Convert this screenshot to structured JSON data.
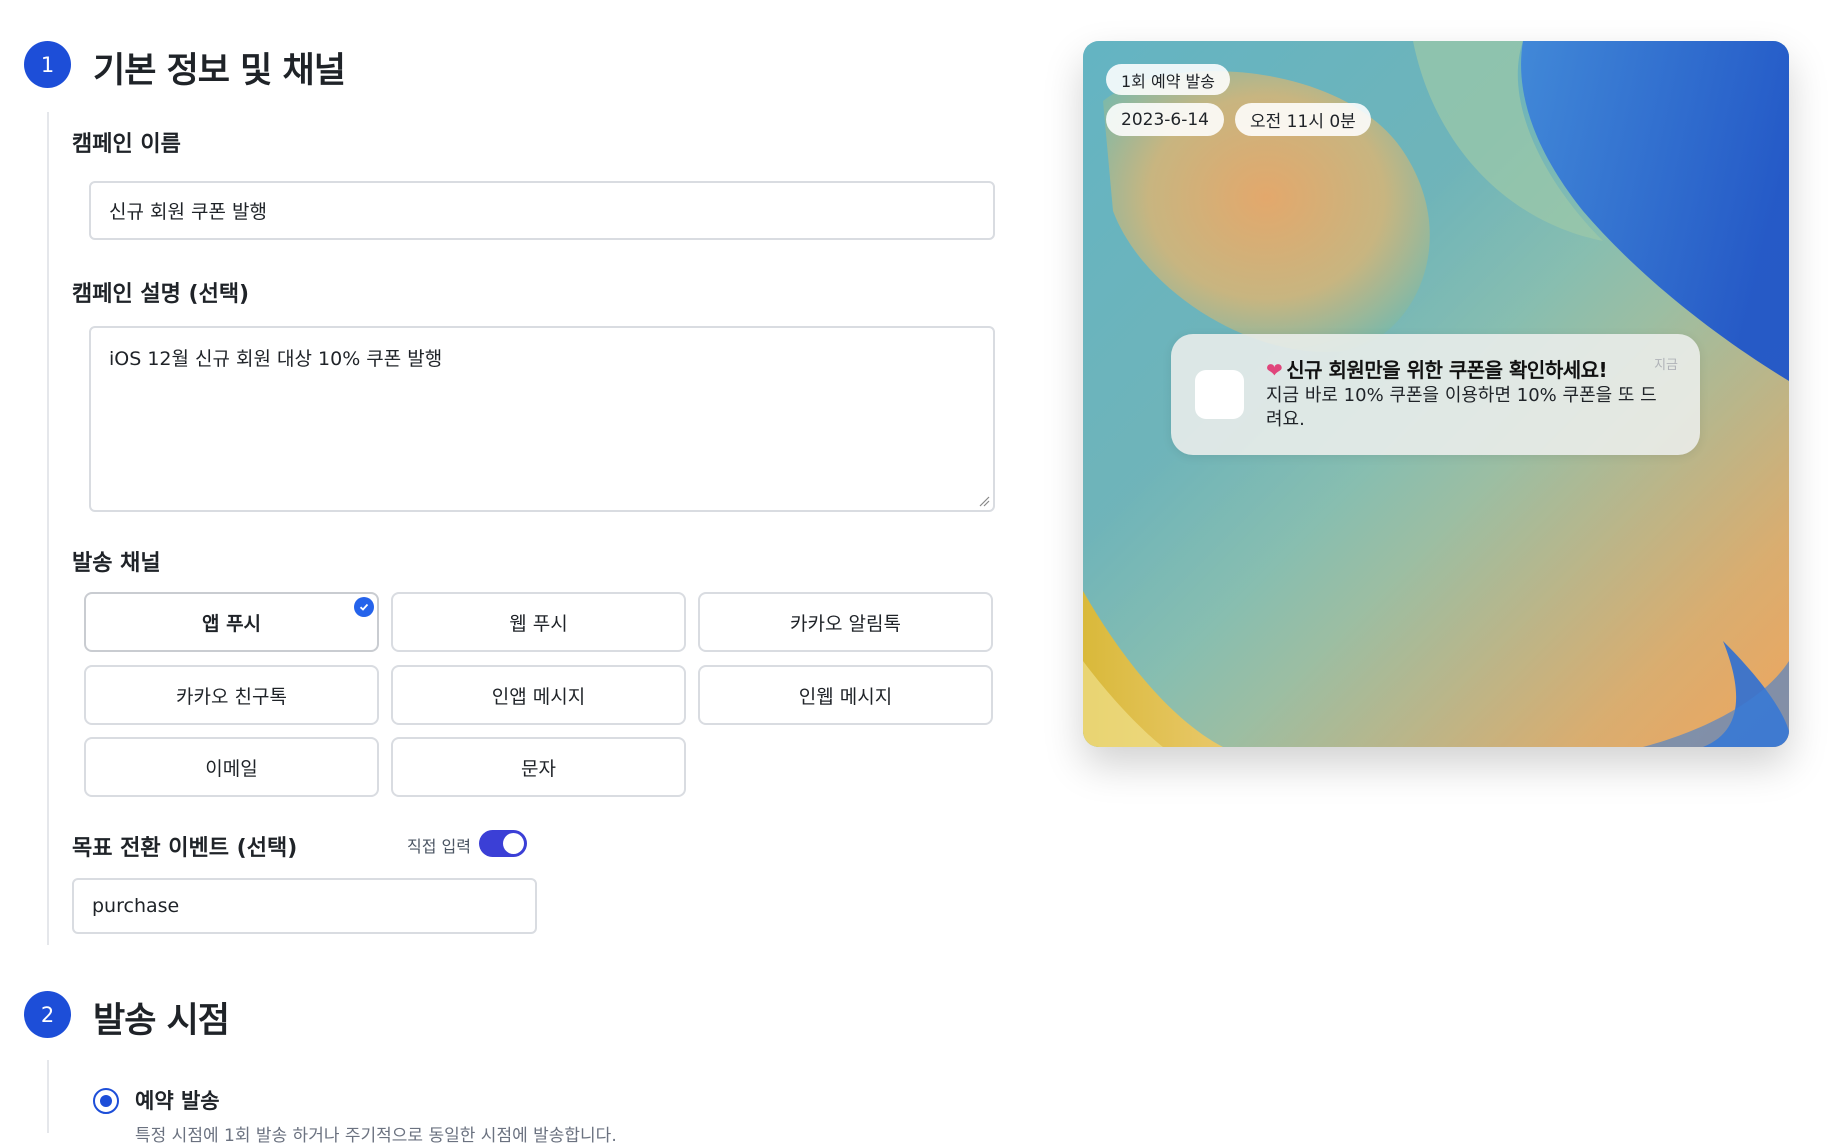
{
  "section1": {
    "number": "1",
    "title": "기본 정보 및 채널",
    "campaign_name_label": "캠페인 이름",
    "campaign_name_value": "신규 회원 쿠폰 발행",
    "campaign_desc_label": "캠페인 설명 (선택)",
    "campaign_desc_value": "iOS 12월 신규 회원 대상 10% 쿠폰 발행",
    "channel_label": "발송 채널",
    "channels": [
      {
        "label": "앱 푸시",
        "selected": true
      },
      {
        "label": "웹 푸시",
        "selected": false
      },
      {
        "label": "카카오 알림톡",
        "selected": false
      },
      {
        "label": "카카오 친구톡",
        "selected": false
      },
      {
        "label": "인앱 메시지",
        "selected": false
      },
      {
        "label": "인웹 메시지",
        "selected": false
      },
      {
        "label": "이메일",
        "selected": false
      },
      {
        "label": "문자",
        "selected": false
      }
    ],
    "goal_label": "목표 전환 이벤트 (선택)",
    "direct_input_label": "직접 입력",
    "direct_input_on": true,
    "goal_value": "purchase"
  },
  "section2": {
    "number": "2",
    "title": "발송 시점",
    "option_label": "예약 발송",
    "option_selected": true,
    "option_desc": "특정 시점에 1회 발송 하거나 주기적으로 동일한 시점에 발송합니다."
  },
  "preview": {
    "schedule_pill": "1회 예약 발송",
    "date_pill": "2023-6-14",
    "time_pill": "오전 11시 0분",
    "notification": {
      "title": "신규 회원만을 위한 쿠폰을 확인하세요!",
      "time": "지금",
      "body": "지금 바로 10% 쿠폰을 이용하면 10% 쿠폰을 또 드려요."
    }
  },
  "colors": {
    "accent": "#1d4ed8",
    "toggle": "#3b3fd6"
  }
}
